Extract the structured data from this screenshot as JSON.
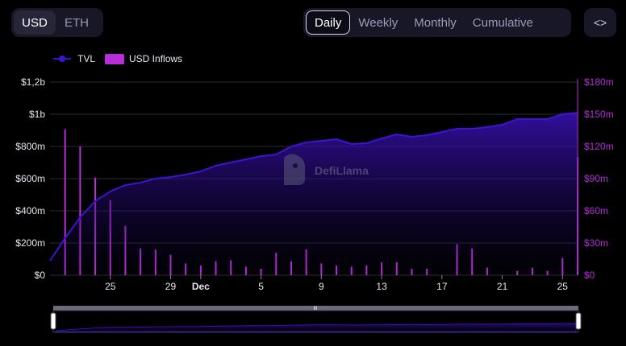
{
  "currency_toggle": {
    "items": [
      "USD",
      "ETH"
    ],
    "selected": "USD"
  },
  "period_toggle": {
    "items": [
      "Daily",
      "Weekly",
      "Monthly",
      "Cumulative"
    ],
    "selected": "Daily"
  },
  "embed_button": {
    "label": "<>",
    "icon": "code-icon"
  },
  "colors": {
    "tvl": "#3f12d6",
    "inflows": "#b92ed8",
    "background": "#000000"
  },
  "watermark": {
    "label": "DefiLlama",
    "icon": "llama-logo-icon"
  },
  "chart_data": {
    "type": "line",
    "legend": [
      "TVL",
      "USD Inflows"
    ],
    "legend_position": "top-left",
    "grid": true,
    "x_ticks": [
      "25",
      "29",
      "Dec",
      "5",
      "9",
      "13",
      "17",
      "21",
      "25"
    ],
    "x_tick_days": [
      25,
      29,
      31,
      35,
      39,
      43,
      47,
      51,
      55
    ],
    "days": [
      21,
      22,
      23,
      24,
      25,
      26,
      27,
      28,
      29,
      30,
      31,
      32,
      33,
      34,
      35,
      36,
      37,
      38,
      39,
      40,
      41,
      42,
      43,
      44,
      45,
      46,
      47,
      48,
      49,
      50,
      51,
      52,
      53,
      54,
      55,
      56
    ],
    "y_left": {
      "ticks": [
        "$0",
        "$200m",
        "$400m",
        "$600m",
        "$800m",
        "$1b",
        "$1,2b"
      ],
      "range": [
        0,
        1200
      ]
    },
    "y_right": {
      "ticks": [
        "$0",
        "$30m",
        "$60m",
        "$90m",
        "$120m",
        "$150m",
        "$180m"
      ],
      "range": [
        0,
        180
      ]
    },
    "series": [
      {
        "name": "TVL",
        "axis": "left",
        "values": [
          90,
          230,
          360,
          460,
          520,
          560,
          575,
          600,
          610,
          625,
          645,
          680,
          700,
          720,
          740,
          750,
          800,
          825,
          835,
          845,
          815,
          820,
          850,
          875,
          860,
          870,
          890,
          910,
          910,
          920,
          935,
          970,
          970,
          970,
          1000,
          1010
        ]
      },
      {
        "name": "USD Inflows",
        "axis": "right",
        "values": [
          0,
          136,
          120,
          91,
          70,
          46,
          25,
          24,
          19,
          11,
          9,
          13,
          14,
          8,
          6,
          21,
          13,
          24,
          11,
          9,
          8,
          9,
          12,
          12,
          6,
          6,
          0,
          29,
          25,
          7,
          0,
          4,
          7,
          4,
          16,
          110
        ]
      }
    ]
  },
  "brush": {
    "handle_label": "III"
  }
}
